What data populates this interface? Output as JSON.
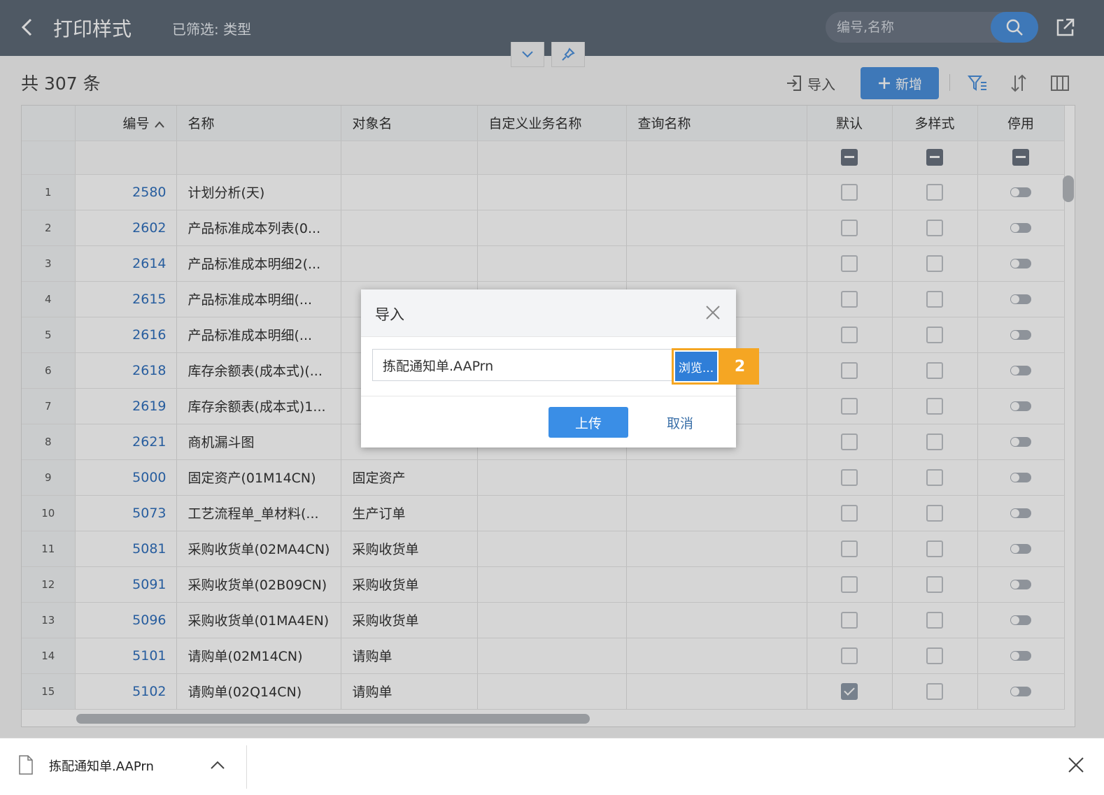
{
  "header": {
    "title": "打印样式",
    "filter_info": "已筛选: 类型",
    "search_placeholder": "编号,名称"
  },
  "toolbar": {
    "count_label": "共 307 条",
    "import_label": "导入",
    "add_label": "新增"
  },
  "table": {
    "columns": [
      "编号",
      "名称",
      "对象名",
      "自定义业务名称",
      "查询名称",
      "默认",
      "多样式",
      "停用"
    ],
    "rows": [
      {
        "num": "1",
        "code": "2580",
        "name": "计划分析(天)",
        "object": "",
        "default_checked": false,
        "multi_checked": false
      },
      {
        "num": "2",
        "code": "2602",
        "name": "产品标准成本列表(0...",
        "object": "",
        "default_checked": false,
        "multi_checked": false
      },
      {
        "num": "3",
        "code": "2614",
        "name": "产品标准成本明细2(...",
        "object": "",
        "default_checked": false,
        "multi_checked": false
      },
      {
        "num": "4",
        "code": "2615",
        "name": "产品标准成本明细(...",
        "object": "",
        "default_checked": false,
        "multi_checked": false
      },
      {
        "num": "5",
        "code": "2616",
        "name": "产品标准成本明细(...",
        "object": "",
        "default_checked": false,
        "multi_checked": false
      },
      {
        "num": "6",
        "code": "2618",
        "name": "库存余额表(成本式)(...",
        "object": "",
        "default_checked": false,
        "multi_checked": false
      },
      {
        "num": "7",
        "code": "2619",
        "name": "库存余额表(成本式)1...",
        "object": "",
        "default_checked": false,
        "multi_checked": false
      },
      {
        "num": "8",
        "code": "2621",
        "name": "商机漏斗图",
        "object": "",
        "default_checked": false,
        "multi_checked": false
      },
      {
        "num": "9",
        "code": "5000",
        "name": "固定资产(01M14CN)",
        "object": "固定资产",
        "default_checked": false,
        "multi_checked": false
      },
      {
        "num": "10",
        "code": "5073",
        "name": "工艺流程单_单材料(...",
        "object": "生产订单",
        "default_checked": false,
        "multi_checked": false
      },
      {
        "num": "11",
        "code": "5081",
        "name": "采购收货单(02MA4CN)",
        "object": "采购收货单",
        "default_checked": false,
        "multi_checked": false
      },
      {
        "num": "12",
        "code": "5091",
        "name": "采购收货单(02B09CN)",
        "object": "采购收货单",
        "default_checked": false,
        "multi_checked": false
      },
      {
        "num": "13",
        "code": "5096",
        "name": "采购收货单(01MA4EN)",
        "object": "采购收货单",
        "default_checked": false,
        "multi_checked": false
      },
      {
        "num": "14",
        "code": "5101",
        "name": "请购单(02M14CN)",
        "object": "请购单",
        "default_checked": false,
        "multi_checked": false
      },
      {
        "num": "15",
        "code": "5102",
        "name": "请购单(02Q14CN)",
        "object": "请购单",
        "default_checked": true,
        "multi_checked": false
      }
    ]
  },
  "modal": {
    "title": "导入",
    "file_value": "拣配通知单.AAPrn",
    "browse_label": "浏览...",
    "step_badge": "2",
    "upload_label": "上传",
    "cancel_label": "取消"
  },
  "download_bar": {
    "file_name": "拣配通知单.AAPrn"
  },
  "colors": {
    "header_bg": "#5f6a78",
    "primary": "#4a8fdc",
    "highlight": "#f5a623",
    "link": "#2f6fbd"
  },
  "icons": [
    "back-arrow-icon",
    "search-icon",
    "export-icon",
    "chevron-down-icon",
    "pin-icon",
    "import-icon",
    "plus-icon",
    "filter-icon",
    "sort-icon",
    "columns-icon",
    "sort-asc-icon",
    "close-icon",
    "file-icon",
    "chevron-up-icon"
  ]
}
